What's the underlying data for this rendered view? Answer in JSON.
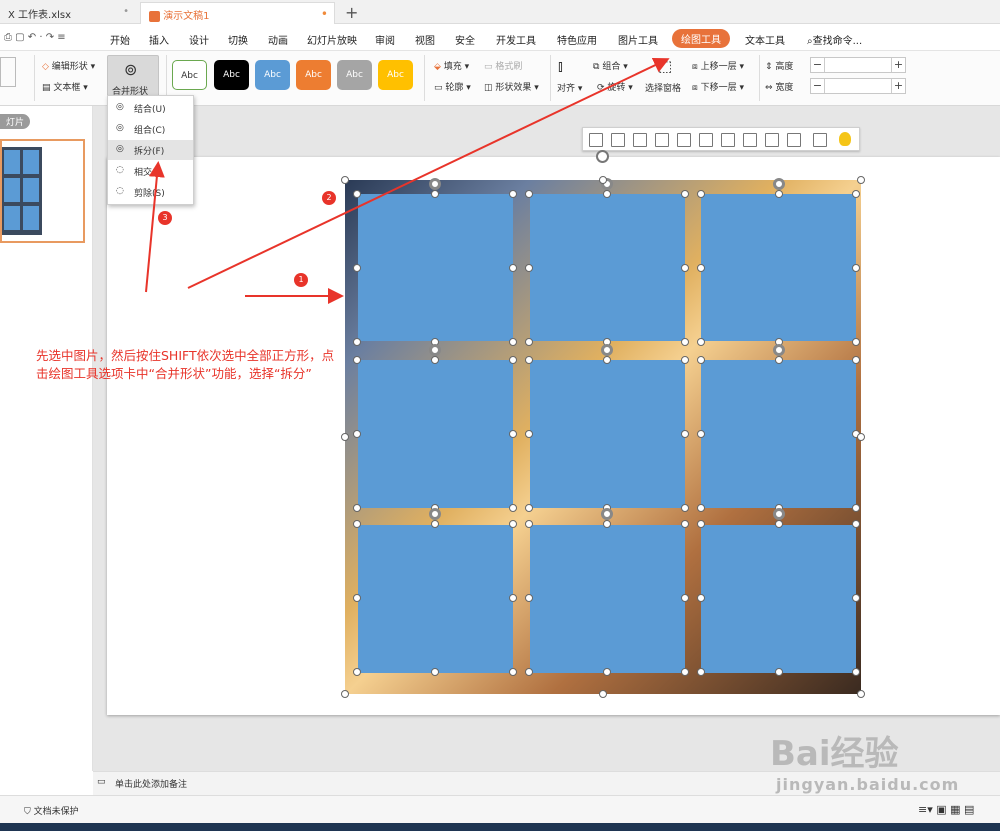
{
  "tabs": [
    {
      "label": "X 工作表.xlsx",
      "close": "•"
    },
    {
      "label": "演示文稿1",
      "modified": "•"
    }
  ],
  "new_tab": "+",
  "menu": [
    "开始",
    "插入",
    "设计",
    "切换",
    "动画",
    "幻灯片放映",
    "审阅",
    "视图",
    "安全",
    "开发工具",
    "特色应用",
    "图片工具",
    "绘图工具",
    "文本工具",
    "查找命令..."
  ],
  "ribbon": {
    "edit_shape": "编辑形状",
    "textbox": "文本框",
    "merge_shapes": "合并形状",
    "style_label": "Abc",
    "fill": "填充",
    "format_painter": "格式刷",
    "outline": "轮廓",
    "shape_effect": "形状效果",
    "align": "对齐",
    "group": "组合",
    "rotate": "旋转",
    "selection_pane": "选择窗格",
    "bring_forward": "上移一层",
    "send_backward": "下移一层",
    "height": "高度",
    "width": "宽度",
    "minus": "−",
    "plus": "+"
  },
  "dropdown": [
    "结合(U)",
    "组合(C)",
    "拆分(F)",
    "相交(I)",
    "剪除(S)"
  ],
  "left_panel": {
    "label": "灯片"
  },
  "annotation": {
    "text": "先选中图片，然后按住SHIFT依次选中全部正方形，点击绘图工具选项卡中“合并形状”功能，选择“拆分”",
    "badges": [
      "1",
      "2",
      "3"
    ]
  },
  "notes": "单击此处添加备注",
  "status": {
    "protect": "文档未保护"
  },
  "watermark": {
    "brand": "Bai经验",
    "url": "jingyan.baidu.com"
  },
  "colors": {
    "accent": "#e8723a",
    "shape": "#5b9bd5",
    "annotation": "#e8342a"
  }
}
